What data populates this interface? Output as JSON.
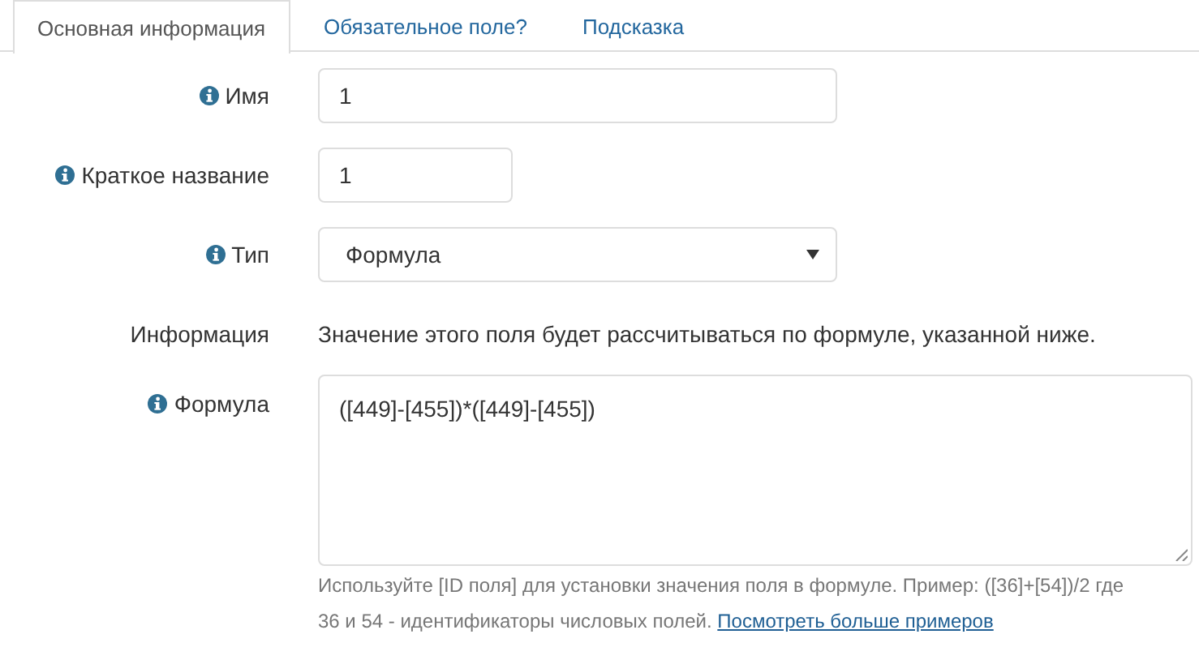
{
  "tabs": [
    {
      "label": "Основная информация",
      "selected": true
    },
    {
      "label": "Обязательное поле?",
      "selected": false
    },
    {
      "label": "Подсказка",
      "selected": false
    }
  ],
  "fields": [
    {
      "kind": "input",
      "label": "Имя",
      "info": true,
      "value": "1"
    },
    {
      "kind": "short-input",
      "label": "Краткое название",
      "info": true,
      "value": "1"
    },
    {
      "kind": "select",
      "label": "Тип",
      "info": true,
      "value": "Формула"
    },
    {
      "kind": "static",
      "label": "Информация",
      "info": false,
      "value": "Значение этого поля будет рассчитываться по формуле, указанной ниже."
    },
    {
      "kind": "textarea",
      "label": "Формула",
      "info": true,
      "value": "([449]-[455])*([449]-[455])",
      "help": "Используйте [ID поля] для установки значения поля в формуле. Пример: ([36]+[54])/2 где 36 и 54 - идентификаторы числовых полей.",
      "help_link": "Посмотреть больше примеров"
    }
  ]
}
